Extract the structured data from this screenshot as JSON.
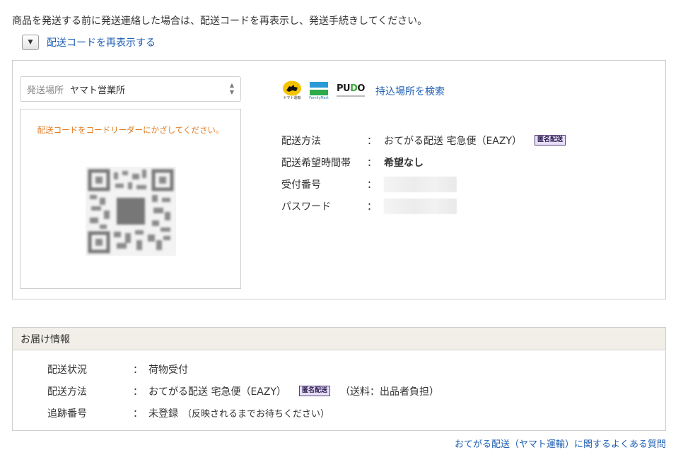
{
  "notice": "商品を発送する前に発送連絡した場合は、配送コードを再表示し、発送手続きしてください。",
  "redisplay": {
    "label": "配送コードを再表示する"
  },
  "code_panel": {
    "location_select": {
      "label": "発送場所",
      "value": "ヤマト営業所"
    },
    "qr_instruction": "配送コードをコードリーダーにかざしてください。",
    "carriers": [
      {
        "name": "yamato",
        "caption": "ヤマト運輸"
      },
      {
        "name": "familymart",
        "caption": "FamilyMart"
      },
      {
        "name": "pudo",
        "caption": "PUDO",
        "parts": [
          "P",
          "U",
          "D",
          "O"
        ]
      }
    ],
    "search_link": "持込場所を検索",
    "info": {
      "method_key": "配送方法",
      "method_value": "おてがる配送 宅急便（EAZY）",
      "anonymous_badge": "匿名配送",
      "time_key": "配送希望時間帯",
      "time_value": "希望なし",
      "receipt_key": "受付番号",
      "password_key": "パスワード",
      "colon": "："
    }
  },
  "delivery": {
    "title": "お届け情報",
    "status_key": "配送状況",
    "status_value": "荷物受付",
    "method_key": "配送方法",
    "method_value": "おてがる配送 宅急便（EAZY）",
    "badge": "匿名配送",
    "method_note": "（送料：出品者負担）",
    "tracking_key": "追跡番号",
    "tracking_value": "未登録",
    "tracking_note": "（反映されるまでお待ちください）",
    "colon": "："
  },
  "faq_link": "おてがる配送（ヤマト運輸）に関するよくある質問",
  "colors": {
    "link": "#1f5fb4",
    "instruction": "#e07b20",
    "badge_bg": "#e7defa",
    "header_bg": "#f1efe8"
  }
}
